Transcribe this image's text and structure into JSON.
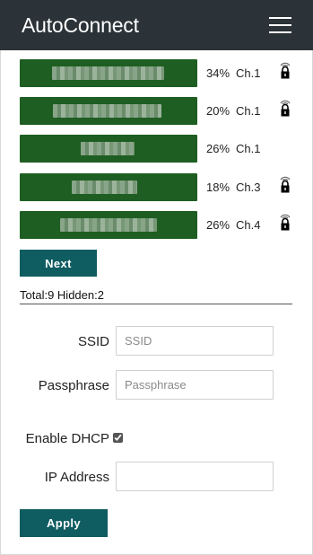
{
  "header": {
    "title": "AutoConnect",
    "menu_icon": "hamburger-menu-icon"
  },
  "colors": {
    "header_bg": "#2b3338",
    "ap_button_bg": "#1e5e22",
    "action_button_bg": "#0f5c61"
  },
  "access_points": [
    {
      "ssid": "xxxxxxxxxxxxxxxx",
      "signal": "34%",
      "channel": "Ch.1",
      "secured": true
    },
    {
      "ssid": "xxxxxxxxxxxxxxxx",
      "signal": "20%",
      "channel": "Ch.1",
      "secured": true
    },
    {
      "ssid": "xxxxxxxxxx",
      "signal": "26%",
      "channel": "Ch.1",
      "secured": false
    },
    {
      "ssid": "xxxxxxxxxxx",
      "signal": "18%",
      "channel": "Ch.3",
      "secured": true
    },
    {
      "ssid": "xxxxxxxxxxxxxxx",
      "signal": "26%",
      "channel": "Ch.4",
      "secured": true
    }
  ],
  "list": {
    "next_label": "Next",
    "summary": "Total:9 Hidden:2"
  },
  "form": {
    "ssid_label": "SSID",
    "ssid_placeholder": "SSID",
    "ssid_value": "",
    "passphrase_label": "Passphrase",
    "passphrase_placeholder": "Passphrase",
    "passphrase_value": "",
    "dhcp_label": "Enable DHCP",
    "dhcp_checked": true,
    "ip_label": "IP Address",
    "ip_value": "",
    "apply_label": "Apply"
  }
}
